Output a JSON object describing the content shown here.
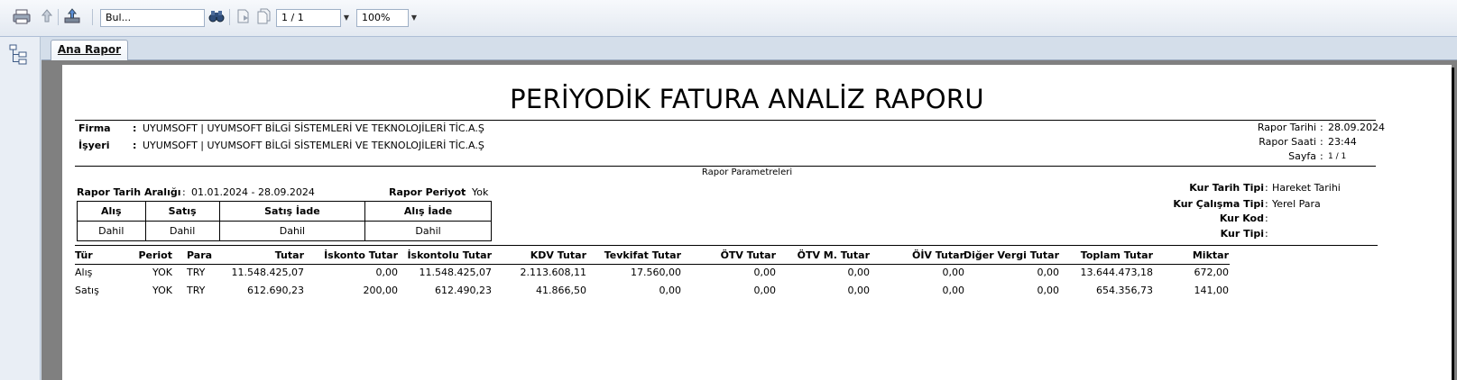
{
  "toolbar": {
    "icons": [
      "print-icon",
      "export-icon",
      "upload-icon",
      "binoculars-icon",
      "page-icon",
      "pages-icon"
    ],
    "search_value": "Bul...",
    "page_value": "1 / 1",
    "zoom_value": "100%"
  },
  "tabs": [
    {
      "label": "Ana Rapor"
    }
  ],
  "report": {
    "title": "PERİYODİK FATURA ANALİZ RAPORU",
    "firma_label": "Firma",
    "firma_value": "UYUMSOFT | UYUMSOFT BİLGİ SİSTEMLERİ VE TEKNOLOJİLERİ TİC.A.Ş",
    "isyeri_label": "İşyeri",
    "isyeri_value": "UYUMSOFT | UYUMSOFT BİLGİ SİSTEMLERİ VE TEKNOLOJİLERİ TİC.A.Ş",
    "colon": ":",
    "rapor_tarihi_label": "Rapor Tarihi",
    "rapor_tarihi_value": "28.09.2024",
    "rapor_saati_label": "Rapor Saati",
    "rapor_saati_value": "23:44",
    "sayfa_label": "Sayfa",
    "sayfa_value": "1 / 1",
    "params_title": "Rapor Parametreleri",
    "tarih_araligi_label": "Rapor Tarih Aralığı",
    "tarih_araligi_value": "01.01.2024 - 28.09.2024",
    "periyot_label": "Rapor Periyot",
    "periyot_value": "Yok",
    "kur_tarih_tipi_label": "Kur Tarih Tipi",
    "kur_tarih_tipi_value": "Hareket Tarihi",
    "kur_calisma_tipi_label": "Kur Çalışma Tipi",
    "kur_calisma_tipi_value": "Yerel Para",
    "kur_kod_label": "Kur Kod",
    "kur_kod_value": "",
    "kur_tipi_label": "Kur Tipi",
    "kur_tipi_value": "",
    "param_table": {
      "headers": [
        "Alış",
        "Satış",
        "Satış İade",
        "Alış İade"
      ],
      "values": [
        "Dahil",
        "Dahil",
        "Dahil",
        "Dahil"
      ]
    },
    "columns": [
      "Tür",
      "Periot",
      "Para",
      "Tutar",
      "İskonto Tutar",
      "İskontolu Tutar",
      "KDV Tutar",
      "Tevkifat Tutar",
      "ÖTV Tutar",
      "ÖTV M. Tutar",
      "ÖİV Tutar",
      "Diğer Vergi Tutar",
      "Toplam Tutar",
      "Miktar"
    ],
    "rows": [
      [
        "Alış",
        "YOK",
        "TRY",
        "11.548.425,07",
        "0,00",
        "11.548.425,07",
        "2.113.608,11",
        "17.560,00",
        "0,00",
        "0,00",
        "0,00",
        "0,00",
        "13.644.473,18",
        "672,00"
      ],
      [
        "Satış",
        "YOK",
        "TRY",
        "612.690,23",
        "200,00",
        "612.490,23",
        "41.866,50",
        "0,00",
        "0,00",
        "0,00",
        "0,00",
        "0,00",
        "654.356,73",
        "141,00"
      ]
    ]
  }
}
